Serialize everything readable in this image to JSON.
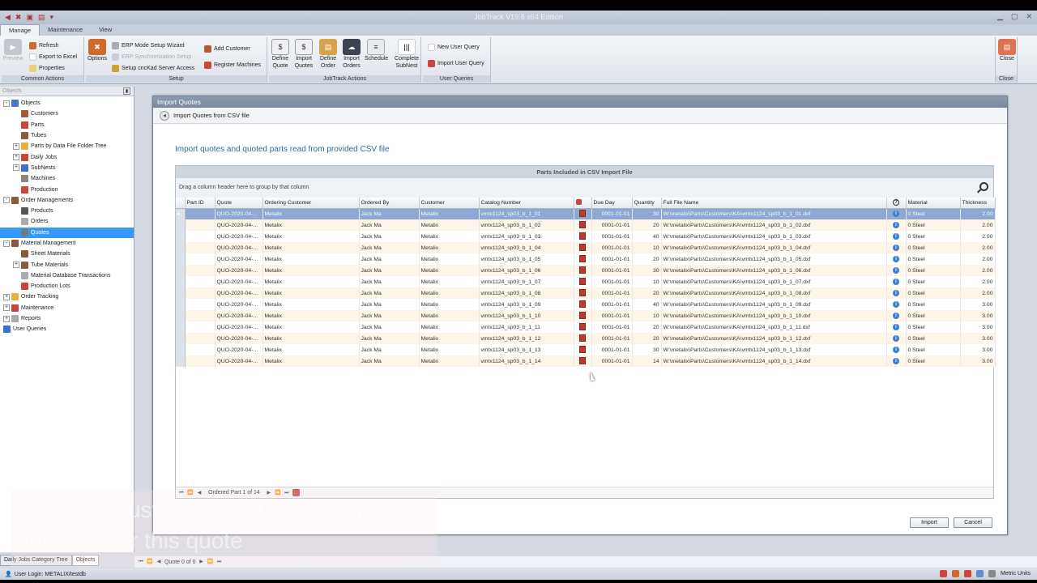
{
  "app": {
    "title": "JobTrack V19.6 x64 Edition",
    "tabs": [
      "Manage",
      "Maintenance",
      "View"
    ]
  },
  "ribbon": {
    "common": {
      "preview": "Preview",
      "refresh": "Refresh",
      "export": "Export to Excel",
      "properties": "Properties",
      "group": "Common Actions"
    },
    "setup": {
      "options": "Options",
      "erp_wizard": "ERP Mode Setup Wizard",
      "erp_sync": "ERP Synchronization Setup",
      "cnckad": "Setup cncKad Server Access",
      "add_customer": "Add Customer",
      "register_machines": "Register Machines",
      "group": "Setup"
    },
    "jobtrack": {
      "define_quote": "Define Quote",
      "import_quotes": "Import Quotes",
      "define_order": "Define Order",
      "import_orders": "Import Orders",
      "schedule": "Schedule",
      "complete_subnest": "Complete SubNest",
      "group": "JobTrack Actions"
    },
    "user_queries": {
      "new": "New User Query",
      "import": "Import User Query",
      "group": "User Queries"
    },
    "close": {
      "label": "Close",
      "group": "Close"
    }
  },
  "left_panel": {
    "header": "Objects",
    "tree": [
      {
        "label": "Objects",
        "level": 0,
        "exp": "-",
        "color": "#4a74c9"
      },
      {
        "label": "Customers",
        "level": 2,
        "color": "#a9553a"
      },
      {
        "label": "Parts",
        "level": 2,
        "color": "#c9463d"
      },
      {
        "label": "Tubes",
        "level": 2,
        "color": "#8a5a3a"
      },
      {
        "label": "Parts by Data File Folder Tree",
        "level": 2,
        "exp": "+",
        "color": "#e3b13c"
      },
      {
        "label": "Daily Jobs",
        "level": 2,
        "exp": "+",
        "color": "#c9463d"
      },
      {
        "label": "SubNests",
        "level": 2,
        "exp": "+",
        "color": "#3d6fc9"
      },
      {
        "label": "Machines",
        "level": 2,
        "color": "#888888"
      },
      {
        "label": "Production",
        "level": 2,
        "color": "#c9463d"
      },
      {
        "label": "Order Managements",
        "level": 0,
        "exp": "-",
        "color": "#8a5a3a"
      },
      {
        "label": "Products",
        "level": 2,
        "color": "#555555"
      },
      {
        "label": "Orders",
        "level": 2,
        "color": "#aaaaaa"
      },
      {
        "label": "Quotes",
        "level": 2,
        "color": "#777777",
        "selected": true
      },
      {
        "label": "Material Management",
        "level": 0,
        "exp": "-",
        "color": "#8a5a3a"
      },
      {
        "label": "Sheet Materials",
        "level": 2,
        "color": "#8a5a3a"
      },
      {
        "label": "Tube Materials",
        "level": 2,
        "exp": "+",
        "color": "#8a5a3a"
      },
      {
        "label": "Material Database Transactions",
        "level": 2,
        "color": "#aaaaaa"
      },
      {
        "label": "Production Lots",
        "level": 2,
        "color": "#c9463d"
      },
      {
        "label": "Order Tracking",
        "level": 0,
        "exp": "+",
        "color": "#e3b13c"
      },
      {
        "label": "Maintenance",
        "level": 0,
        "exp": "+",
        "color": "#c9463d"
      },
      {
        "label": "Reports",
        "level": 0,
        "exp": "+",
        "color": "#aaaaaa"
      },
      {
        "label": "User Queries",
        "level": 0,
        "color": "#3d6fc9"
      }
    ],
    "bottom_tabs": [
      "Daily Jobs Category Tree",
      "Objects"
    ]
  },
  "record_nav": "Quote 0 of 0",
  "status": {
    "login": "User Login: METALIX/testdb",
    "units": "Metric Units"
  },
  "dialog": {
    "title": "Import Quotes",
    "header": "Import Quotes from CSV file",
    "subtitle": "Import quotes and quoted parts read from provided CSV file",
    "grid_caption": "Parts Included in CSV Import File",
    "group_hint": "Drag a column header here to group by that column",
    "columns": [
      "Part ID",
      "Quote",
      "Ordering Customer",
      "Ordered By",
      "Customer",
      "Catalog Number",
      "",
      "Due Day",
      "Quantity",
      "Full File Name",
      "?",
      "Material",
      "Thickness"
    ],
    "rows": [
      {
        "quote": "QUO-2020-04-...",
        "ordering_customer": "Metalix",
        "ordered_by": "Jack Ma",
        "customer": "Metalix",
        "catalog": "vmtx1124_sp03_b_1_01",
        "due": "0001-01-01",
        "qty": "30",
        "file": "W:\\metalix\\Parts\\Customers\\KA\\vmtx1124_sp03_b_1_01.dxf",
        "material": "0 Steel",
        "thickness": "2.00"
      },
      {
        "quote": "QUO-2020-04-...",
        "ordering_customer": "Metalix",
        "ordered_by": "Jack Ma",
        "customer": "Metalix",
        "catalog": "vmtx1124_sp03_b_1_02",
        "due": "0001-01-01",
        "qty": "20",
        "file": "W:\\metalix\\Parts\\Customers\\KA\\vmtx1124_sp03_b_1_02.dxf",
        "material": "0 Steel",
        "thickness": "2.00"
      },
      {
        "quote": "QUO-2020-04-...",
        "ordering_customer": "Metalix",
        "ordered_by": "Jack Ma",
        "customer": "Metalix",
        "catalog": "vmtx1124_sp03_b_1_03",
        "due": "0001-01-01",
        "qty": "40",
        "file": "W:\\metalix\\Parts\\Customers\\KA\\vmtx1124_sp03_b_1_03.dxf",
        "material": "0 Steel",
        "thickness": "2.00"
      },
      {
        "quote": "QUO-2020-04-...",
        "ordering_customer": "Metalix",
        "ordered_by": "Jack Ma",
        "customer": "Metalix",
        "catalog": "vmtx1124_sp03_b_1_04",
        "due": "0001-01-01",
        "qty": "10",
        "file": "W:\\metalix\\Parts\\Customers\\KA\\vmtx1124_sp03_b_1_04.dxf",
        "material": "0 Steel",
        "thickness": "2.00"
      },
      {
        "quote": "QUO-2020-04-...",
        "ordering_customer": "Metalix",
        "ordered_by": "Jack Ma",
        "customer": "Metalix",
        "catalog": "vmtx1124_sp03_b_1_05",
        "due": "0001-01-01",
        "qty": "20",
        "file": "W:\\metalix\\Parts\\Customers\\KA\\vmtx1124_sp03_b_1_05.dxf",
        "material": "0 Steel",
        "thickness": "2.00"
      },
      {
        "quote": "QUO-2020-04-...",
        "ordering_customer": "Metalix",
        "ordered_by": "Jack Ma",
        "customer": "Metalix",
        "catalog": "vmtx1124_sp03_b_1_06",
        "due": "0001-01-01",
        "qty": "30",
        "file": "W:\\metalix\\Parts\\Customers\\KA\\vmtx1124_sp03_b_1_06.dxf",
        "material": "0 Steel",
        "thickness": "2.00"
      },
      {
        "quote": "QUO-2020-04-...",
        "ordering_customer": "Metalix",
        "ordered_by": "Jack Ma",
        "customer": "Metalix",
        "catalog": "vmtx1124_sp03_b_1_07",
        "due": "0001-01-01",
        "qty": "10",
        "file": "W:\\metalix\\Parts\\Customers\\KA\\vmtx1124_sp03_b_1_07.dxf",
        "material": "0 Steel",
        "thickness": "2.00"
      },
      {
        "quote": "QUO-2020-04-...",
        "ordering_customer": "Metalix",
        "ordered_by": "Jack Ma",
        "customer": "Metalix",
        "catalog": "vmtx1124_sp03_b_1_08",
        "due": "0001-01-01",
        "qty": "20",
        "file": "W:\\metalix\\Parts\\Customers\\KA\\vmtx1124_sp03_b_1_08.dxf",
        "material": "0 Steel",
        "thickness": "2.00"
      },
      {
        "quote": "QUO-2020-04-...",
        "ordering_customer": "Metalix",
        "ordered_by": "Jack Ma",
        "customer": "Metalix",
        "catalog": "vmtx1124_sp03_b_1_09",
        "due": "0001-01-01",
        "qty": "40",
        "file": "W:\\metalix\\Parts\\Customers\\KA\\vmtx1124_sp03_b_1_09.dxf",
        "material": "0 Steel",
        "thickness": "3.00"
      },
      {
        "quote": "QUO-2020-04-...",
        "ordering_customer": "Metalix",
        "ordered_by": "Jack Ma",
        "customer": "Metalix",
        "catalog": "vmtx1124_sp03_b_1_10",
        "due": "0001-01-01",
        "qty": "10",
        "file": "W:\\metalix\\Parts\\Customers\\KA\\vmtx1124_sp03_b_1_10.dxf",
        "material": "0 Steel",
        "thickness": "3.00"
      },
      {
        "quote": "QUO-2020-04-...",
        "ordering_customer": "Metalix",
        "ordered_by": "Jack Ma",
        "customer": "Metalix",
        "catalog": "vmtx1124_sp03_b_1_11",
        "due": "0001-01-01",
        "qty": "20",
        "file": "W:\\metalix\\Parts\\Customers\\KA\\vmtx1124_sp03_b_1_11.dxf",
        "material": "0 Steel",
        "thickness": "3.00"
      },
      {
        "quote": "QUO-2020-04-...",
        "ordering_customer": "Metalix",
        "ordered_by": "Jack Ma",
        "customer": "Metalix",
        "catalog": "vmtx1124_sp03_b_1_12",
        "due": "0001-01-01",
        "qty": "20",
        "file": "W:\\metalix\\Parts\\Customers\\KA\\vmtx1124_sp03_b_1_12.dxf",
        "material": "0 Steel",
        "thickness": "3.00"
      },
      {
        "quote": "QUO-2020-04-...",
        "ordering_customer": "Metalix",
        "ordered_by": "Jack Ma",
        "customer": "Metalix",
        "catalog": "vmtx1124_sp03_b_1_13",
        "due": "0001-01-01",
        "qty": "30",
        "file": "W:\\metalix\\Parts\\Customers\\KA\\vmtx1124_sp03_b_1_13.dxf",
        "material": "0 Steel",
        "thickness": "3.00"
      },
      {
        "quote": "QUO-2020-04-...",
        "ordering_customer": "Metalix",
        "ordered_by": "Jack Ma",
        "customer": "Metalix",
        "catalog": "vmtx1124_sp03_b_1_14",
        "due": "0001-01-01",
        "qty": "14",
        "file": "W:\\metalix\\Parts\\Customers\\KA\\vmtx1124_sp03_b_1_14.dxf",
        "material": "0 Steel",
        "thickness": "3.00"
      }
    ],
    "pager_text": "Ordered Part 1 of 14",
    "import_button": "Import",
    "cancel_button": "Cancel"
  },
  "caption_text": "Selecting customer, contact person and due date for this quote"
}
